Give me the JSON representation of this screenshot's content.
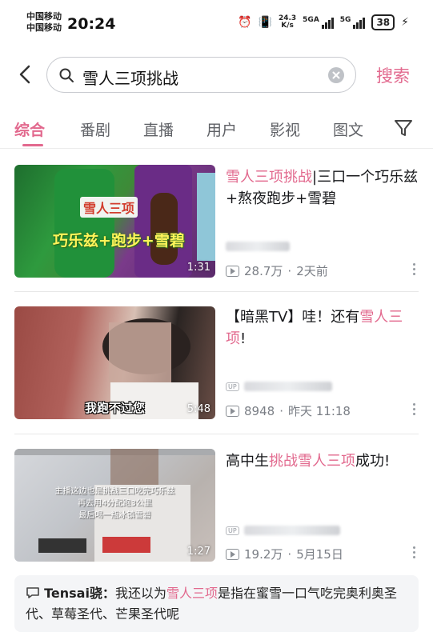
{
  "status_bar": {
    "carrier_1": "中国移动",
    "carrier_2": "中国移动",
    "time": "20:24",
    "net_speed_value": "24.3",
    "net_speed_unit": "K/s",
    "sim1_label": "5GA",
    "sim2_label": "5G",
    "battery": "38"
  },
  "search": {
    "query": "雪人三项挑战",
    "button_label": "搜索"
  },
  "tabs": [
    "综合",
    "番剧",
    "直播",
    "用户",
    "影视",
    "图文"
  ],
  "active_tab": 0,
  "results": [
    {
      "title_hl": "雪人三项挑战",
      "title_rest": "|三口一个巧乐兹+熬夜跑步+雪碧",
      "thumb_caption_1": "雪人三项",
      "thumb_caption_2": "巧乐兹+跑步+雪碧",
      "duration": "1:31",
      "views": "28.7万",
      "date": "2天前"
    },
    {
      "title_pre": "【暗黑TV】哇！还有",
      "title_hl": "雪人三项",
      "title_post": "!",
      "thumb_caption": "我跑不过您",
      "duration": "5:48",
      "views": "8948",
      "date": "昨天 11:18"
    },
    {
      "title_pre": "高中生",
      "title_hl": "挑战雪人三项",
      "title_post": "成功!",
      "thumb_caption_1": "主播这边也是挑战三口吃完巧乐兹",
      "thumb_caption_2": "再去用4分配跑3公里",
      "thumb_caption_3": "最后喝一瓶冰镇雪碧",
      "duration": "1:27",
      "views": "19.2万",
      "date": "5月15日"
    }
  ],
  "comment": {
    "user": "Tensai骁：",
    "text_pre": "我还以为",
    "text_hl": "雪人三项",
    "text_post": "是指在蜜雪一口气吃完奥利奥圣代、草莓圣代、芒果圣代呢"
  },
  "colors": {
    "accent": "#e2698e",
    "muted": "#9499a0"
  }
}
